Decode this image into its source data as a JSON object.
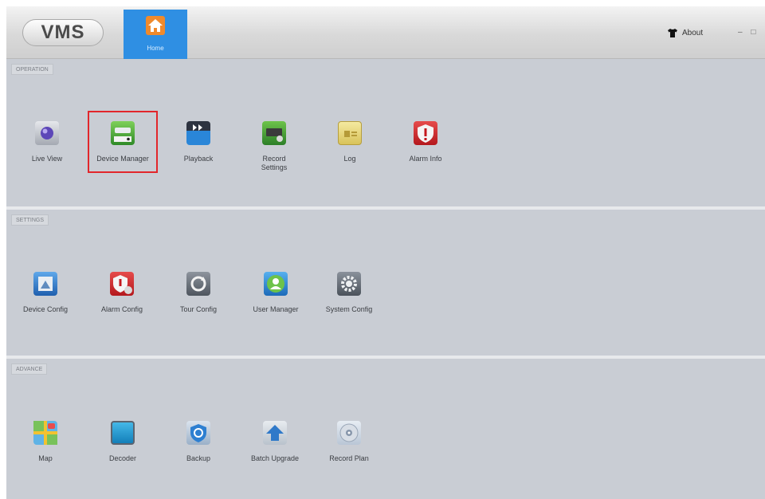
{
  "app": {
    "logo": "VMS"
  },
  "home_tab": {
    "label": "Home"
  },
  "header": {
    "about_label": "About",
    "window_controls": "– □"
  },
  "sections": [
    {
      "tag": "OPERATION",
      "items": [
        {
          "label": "Live View",
          "icon": "live-view-icon"
        },
        {
          "label": "Device Manager",
          "icon": "device-manager-icon"
        },
        {
          "label": "Playback",
          "icon": "playback-icon"
        },
        {
          "label": "Record\nSettings",
          "icon": "record-settings-icon"
        },
        {
          "label": "Log",
          "icon": "log-icon"
        },
        {
          "label": "Alarm Info",
          "icon": "alarm-info-icon"
        }
      ]
    },
    {
      "tag": "SETTINGS",
      "items": [
        {
          "label": "Device Config",
          "icon": "device-config-icon"
        },
        {
          "label": "Alarm Config",
          "icon": "alarm-config-icon"
        },
        {
          "label": "Tour Config",
          "icon": "tour-config-icon"
        },
        {
          "label": "User Manager",
          "icon": "user-manager-icon"
        },
        {
          "label": "System Config",
          "icon": "system-config-icon"
        }
      ]
    },
    {
      "tag": "ADVANCE",
      "items": [
        {
          "label": "Map",
          "icon": "map-icon"
        },
        {
          "label": "Decoder",
          "icon": "decoder-icon"
        },
        {
          "label": "Backup",
          "icon": "backup-icon"
        },
        {
          "label": "Batch Upgrade",
          "icon": "batch-upgrade-icon"
        },
        {
          "label": "Record Plan",
          "icon": "record-plan-icon"
        }
      ]
    }
  ]
}
